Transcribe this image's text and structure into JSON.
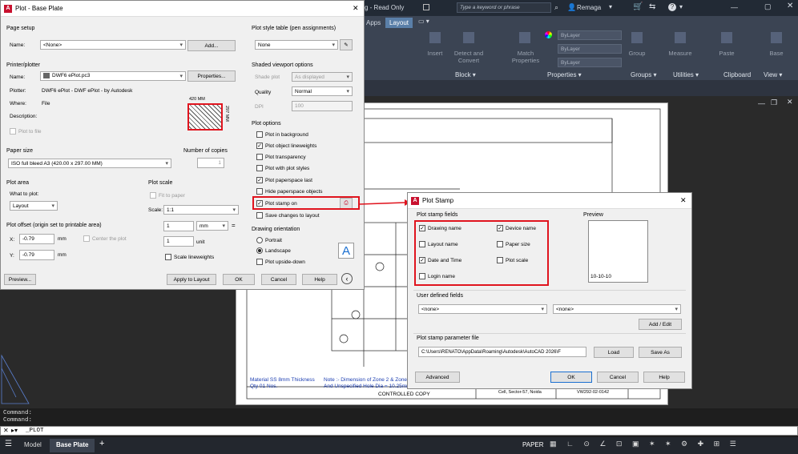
{
  "app": {
    "title_fragment": "g - Read Only",
    "search_placeholder": "Type a keyword or phrase",
    "user": "Remaga",
    "colors": {
      "accent": "#c8102e",
      "ribbon": "#3b4453",
      "highlight": "#e0141e"
    }
  },
  "ribbon": {
    "tabs": [
      "Apps",
      "Layout"
    ],
    "active_tab": "Layout",
    "buttons": [
      "Insert",
      "Detect and Convert",
      "Match Properties",
      "Group",
      "Measure",
      "Paste",
      "Base"
    ],
    "bylayer": [
      "ByLayer",
      "ByLayer",
      "ByLayer"
    ],
    "panels": [
      "Block ▾",
      "Properties ▾",
      "Groups ▾",
      "Utilities ▾",
      "Clipboard",
      "View ▾"
    ]
  },
  "plot_dialog": {
    "title": "Plot - Base Plate",
    "page_setup": {
      "label": "Page setup",
      "name_label": "Name:",
      "name_value": "<None>",
      "add_button": "Add..."
    },
    "printer": {
      "label": "Printer/plotter",
      "name_label": "Name:",
      "name_value": "DWF6 ePlot.pc3",
      "properties_button": "Properties...",
      "plotter_label": "Plotter:",
      "plotter_value": "DWF6 ePlot - DWF ePlot - by Autodesk",
      "where_label": "Where:",
      "where_value": "File",
      "description_label": "Description:",
      "plot_to_file": "Plot to file",
      "preview_width": "420 MM",
      "preview_height": "297 MM"
    },
    "paper_size": {
      "label": "Paper size",
      "value": "ISO full bleed A3 (420.00 x 297.00 MM)"
    },
    "copies": {
      "label": "Number of copies",
      "value": "1"
    },
    "plot_area": {
      "label": "Plot area",
      "what_label": "What to plot:",
      "what_value": "Layout"
    },
    "plot_scale": {
      "label": "Plot scale",
      "fit": "Fit to paper",
      "scale_label": "Scale:",
      "scale_value": "1:1",
      "value1": "1",
      "units": "mm",
      "value2": "1",
      "unit_label": "unit",
      "scale_lw": "Scale lineweights"
    },
    "plot_offset": {
      "label": "Plot offset (origin set to printable area)",
      "x_label": "X:",
      "x_value": "-0.79",
      "y_label": "Y:",
      "y_value": "-0.79",
      "unit": "mm",
      "center": "Center the plot"
    },
    "style_table": {
      "label": "Plot style table (pen assignments)",
      "value": "None"
    },
    "shaded": {
      "label": "Shaded viewport options",
      "shade_label": "Shade plot",
      "shade_value": "As displayed",
      "quality_label": "Quality",
      "quality_value": "Normal",
      "dpi_label": "DPI",
      "dpi_value": "100"
    },
    "options": {
      "label": "Plot options",
      "items": [
        {
          "label": "Plot in background",
          "checked": false
        },
        {
          "label": "Plot object lineweights",
          "checked": true
        },
        {
          "label": "Plot transparency",
          "checked": false
        },
        {
          "label": "Plot with plot styles",
          "checked": false
        },
        {
          "label": "Plot paperspace last",
          "checked": true
        },
        {
          "label": "Hide paperspace objects",
          "checked": false
        },
        {
          "label": "Plot stamp on",
          "checked": true
        },
        {
          "label": "Save changes to layout",
          "checked": false
        }
      ]
    },
    "orientation": {
      "label": "Drawing orientation",
      "portrait": "Portrait",
      "landscape": "Landscape",
      "upside": "Plot upside-down",
      "selected": "Landscape"
    },
    "buttons": {
      "preview": "Preview...",
      "apply": "Apply to Layout",
      "ok": "OK",
      "cancel": "Cancel",
      "help": "Help"
    }
  },
  "stamp_dialog": {
    "title": "Plot Stamp",
    "fields_label": "Plot stamp fields",
    "fields": [
      {
        "label": "Drawing name",
        "checked": true
      },
      {
        "label": "Device name",
        "checked": true
      },
      {
        "label": "Layout name",
        "checked": false
      },
      {
        "label": "Paper size",
        "checked": false
      },
      {
        "label": "Date and Time",
        "checked": true
      },
      {
        "label": "Plot scale",
        "checked": false
      },
      {
        "label": "Login name",
        "checked": false
      }
    ],
    "preview_label": "Preview",
    "preview_text": "10-10-10",
    "user_fields_label": "User defined fields",
    "user_field1": "<none>",
    "user_field2": "<none>",
    "add_edit": "Add / Edit",
    "param_label": "Plot stamp parameter file",
    "param_path": "C:\\Users\\RENATO\\AppData\\Roaming\\Autodesk\\AutoCAD 2026\\F",
    "load": "Load",
    "save_as": "Save As",
    "advanced": "Advanced",
    "ok": "OK",
    "cancel": "Cancel",
    "help": "Help"
  },
  "drawing": {
    "note1": "Material SS 8mm Thickness",
    "note2": "Qty 01 Nos.",
    "note3": "Note :- Dimension of Zone 2 & Zone",
    "note4": "And Unspecified Hole Dia = 10.25mm",
    "controlled": "CONTROLLED COPY",
    "address": "Cell, Sector-57, Noida",
    "docno": "VW292-02-0142"
  },
  "command": {
    "line1": "Command:",
    "line2": "Command:",
    "prompt": "_PLOT"
  },
  "status": {
    "tabs": [
      "Model",
      "Base Plate"
    ],
    "active": "Base Plate",
    "paper": "PAPER"
  }
}
